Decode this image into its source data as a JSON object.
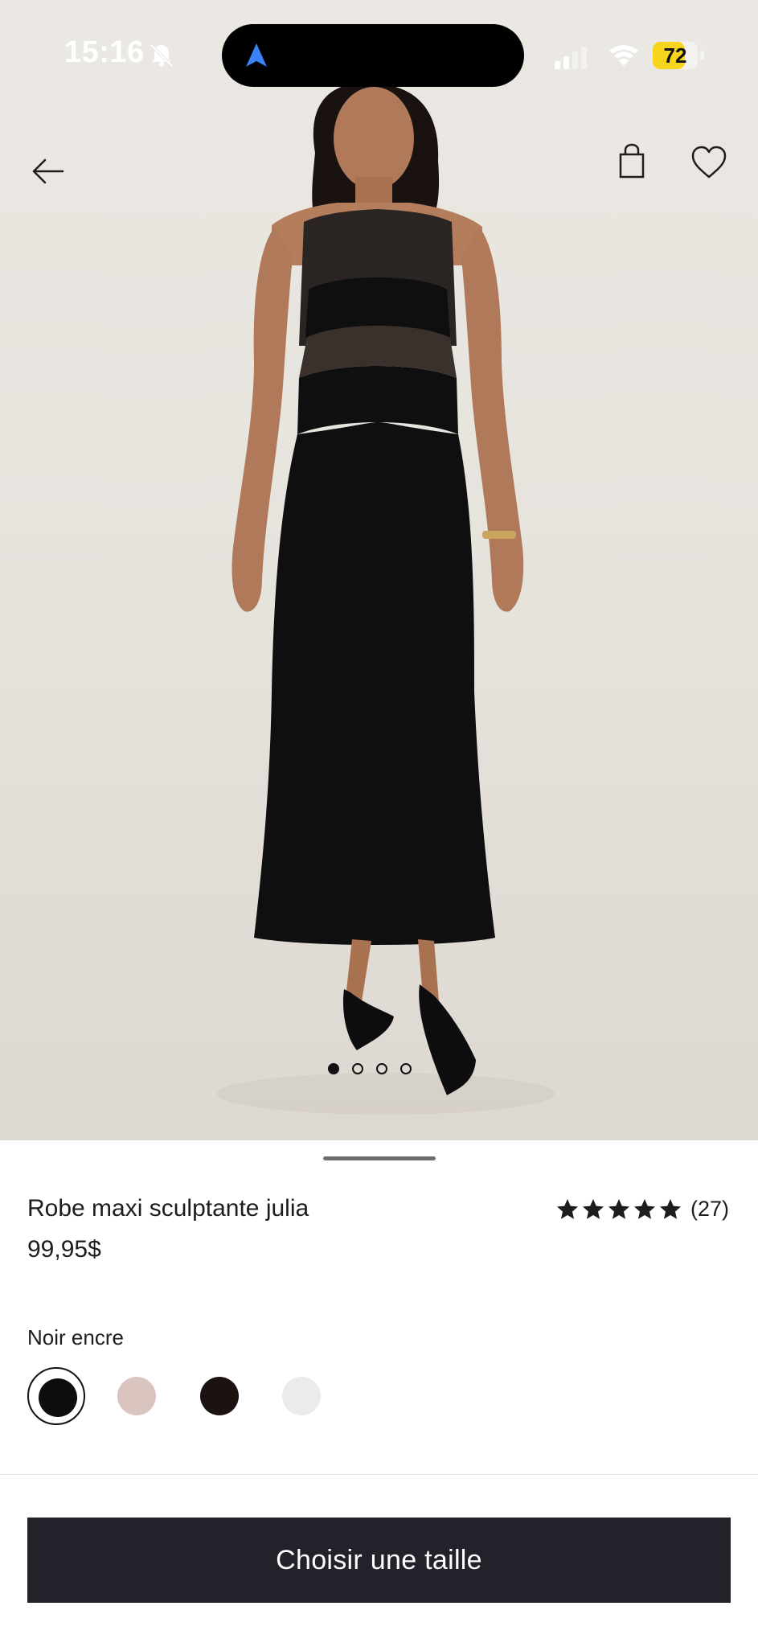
{
  "status_bar": {
    "time": "15:16",
    "battery_percent": "72",
    "battery_level": 0.72,
    "icons": [
      "bell-slash-icon",
      "location-arrow-icon",
      "cellular-signal-icon",
      "wifi-icon",
      "battery-icon"
    ],
    "colors": {
      "battery_fill": "#f8d51d",
      "location_arrow": "#3b82f6"
    }
  },
  "top_nav": {
    "icons": [
      "arrow-left-icon",
      "shopping-bag-icon",
      "heart-icon"
    ]
  },
  "carousel": {
    "total_images": 4,
    "active_index": 0
  },
  "product": {
    "title": "Robe maxi sculptante julia",
    "price": "99,95$",
    "rating": 5,
    "review_count": "(27)"
  },
  "color_selection": {
    "selected_label": "Noir encre",
    "swatches": [
      {
        "name": "Noir encre",
        "color": "#0d0d0d",
        "selected": true
      },
      {
        "name": "swatch-2",
        "color": "#d9c4c0",
        "selected": false
      },
      {
        "name": "swatch-3",
        "color": "#1c1210",
        "selected": false
      },
      {
        "name": "swatch-4",
        "color": "#ebebe9",
        "selected": false
      }
    ]
  },
  "cta": {
    "label": "Choisir une taille",
    "color": "#22222a"
  }
}
